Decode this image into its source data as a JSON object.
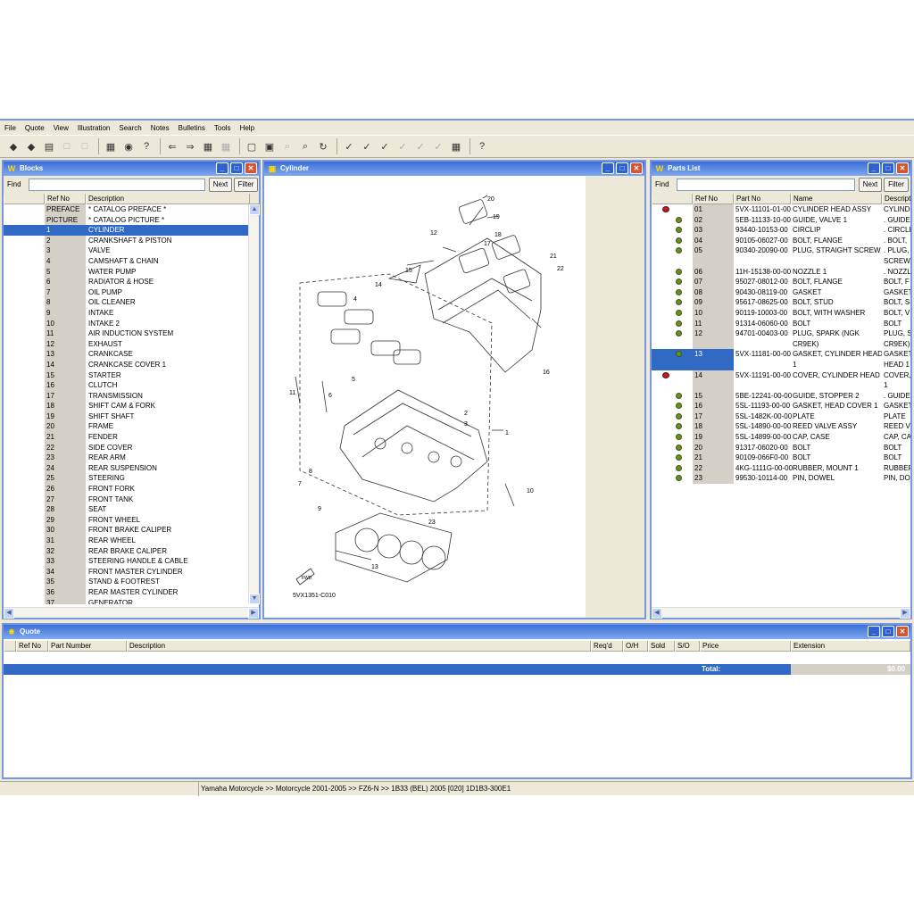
{
  "menu": [
    "File",
    "Quote",
    "View",
    "Illustration",
    "Search",
    "Notes",
    "Bulletins",
    "Tools",
    "Help"
  ],
  "blocks": {
    "title": "Blocks",
    "find_label": "Find",
    "next_label": "Next",
    "filter_label": "Filter",
    "headers": [
      "Ref No",
      "Description"
    ],
    "rows": [
      [
        "PREFACE",
        "* CATALOG PREFACE *"
      ],
      [
        "PICTURE",
        "* CATALOG PICTURE *"
      ],
      [
        "1",
        "CYLINDER"
      ],
      [
        "2",
        "CRANKSHAFT & PISTON"
      ],
      [
        "3",
        "VALVE"
      ],
      [
        "4",
        "CAMSHAFT & CHAIN"
      ],
      [
        "5",
        "WATER PUMP"
      ],
      [
        "6",
        "RADIATOR & HOSE"
      ],
      [
        "7",
        "OIL PUMP"
      ],
      [
        "8",
        "OIL CLEANER"
      ],
      [
        "9",
        "INTAKE"
      ],
      [
        "10",
        "INTAKE 2"
      ],
      [
        "11",
        "AIR INDUCTION SYSTEM"
      ],
      [
        "12",
        "EXHAUST"
      ],
      [
        "13",
        "CRANKCASE"
      ],
      [
        "14",
        "CRANKCASE COVER 1"
      ],
      [
        "15",
        "STARTER"
      ],
      [
        "16",
        "CLUTCH"
      ],
      [
        "17",
        "TRANSMISSION"
      ],
      [
        "18",
        "SHIFT CAM & FORK"
      ],
      [
        "19",
        "SHIFT SHAFT"
      ],
      [
        "20",
        "FRAME"
      ],
      [
        "21",
        "FENDER"
      ],
      [
        "22",
        "SIDE COVER"
      ],
      [
        "23",
        "REAR ARM"
      ],
      [
        "24",
        "REAR SUSPENSION"
      ],
      [
        "25",
        "STEERING"
      ],
      [
        "26",
        "FRONT FORK"
      ],
      [
        "27",
        "FRONT TANK"
      ],
      [
        "28",
        "SEAT"
      ],
      [
        "29",
        "FRONT WHEEL"
      ],
      [
        "30",
        "FRONT BRAKE CALIPER"
      ],
      [
        "31",
        "REAR WHEEL"
      ],
      [
        "32",
        "REAR BRAKE CALIPER"
      ],
      [
        "33",
        "STEERING HANDLE & CABLE"
      ],
      [
        "34",
        "FRONT MASTER CYLINDER"
      ],
      [
        "35",
        "STAND & FOOTREST"
      ],
      [
        "36",
        "REAR MASTER CYLINDER"
      ],
      [
        "37",
        "GENERATOR"
      ]
    ]
  },
  "cylinder": {
    "title": "Cylinder",
    "diagram_code": "5VX1351-C010",
    "fwd_label": "FWD",
    "callouts": [
      "20",
      "19",
      "18",
      "17",
      "16",
      "15",
      "14",
      "12",
      "22",
      "21",
      "4",
      "1",
      "2",
      "3",
      "5",
      "6",
      "7",
      "8",
      "9",
      "10",
      "11",
      "13",
      "23"
    ]
  },
  "parts": {
    "title": "Parts List",
    "find_label": "Find",
    "next_label": "Next",
    "filter_label": "Filter",
    "headers": [
      "Ref No",
      "Part No",
      "Name",
      "Descript"
    ],
    "rows": [
      {
        "icon": "red",
        "ref": "01",
        "part": "5VX-11101-01-00",
        "name": "CYLINDER HEAD ASSY",
        "desc": "CYLIND"
      },
      {
        "icon": "green",
        "ref": "02",
        "part": "5EB-11133-10-00",
        "name": "GUIDE, VALVE 1",
        "desc": ". GUIDE"
      },
      {
        "icon": "green",
        "ref": "03",
        "part": "93440-10153-00",
        "name": "CIRCLIP",
        "desc": ". CIRCLI"
      },
      {
        "icon": "green",
        "ref": "04",
        "part": "90105-06027-00",
        "name": "BOLT, FLANGE",
        "desc": ". BOLT,"
      },
      {
        "icon": "green",
        "ref": "05",
        "part": "90340-20090-00",
        "name": "PLUG, STRAIGHT SCREW",
        "desc": ". PLUG,",
        "name2": "",
        "desc2": "SCREW"
      },
      {
        "icon": "green",
        "ref": "06",
        "part": "11H-15138-00-00",
        "name": "NOZZLE 1",
        "desc": ". NOZZL"
      },
      {
        "icon": "green",
        "ref": "07",
        "part": "95027-08012-00",
        "name": "BOLT, FLANGE",
        "desc": "BOLT, F"
      },
      {
        "icon": "green",
        "ref": "08",
        "part": "90430-08119-00",
        "name": "GASKET",
        "desc": "GASKET"
      },
      {
        "icon": "green",
        "ref": "09",
        "part": "95617-08625-00",
        "name": "BOLT, STUD",
        "desc": "BOLT, S"
      },
      {
        "icon": "green",
        "ref": "10",
        "part": "90119-10003-00",
        "name": "BOLT, WITH WASHER",
        "desc": "BOLT, V"
      },
      {
        "icon": "green",
        "ref": "11",
        "part": "91314-06060-00",
        "name": "BOLT",
        "desc": "BOLT"
      },
      {
        "icon": "green",
        "ref": "12",
        "part": "94701-00403-00",
        "name": "PLUG, SPARK (NGK",
        "desc": "PLUG, S",
        "name2": "CR9EK)",
        "desc2": "CR9EK)"
      },
      {
        "icon": "green",
        "ref": "13",
        "part": "5VX-11181-00-00",
        "name": "GASKET, CYLINDER HEAD",
        "desc": "GASKET",
        "name2": "1",
        "desc2": "HEAD 1",
        "selected": true
      },
      {
        "icon": "red",
        "ref": "14",
        "part": "5VX-11191-00-00",
        "name": "COVER, CYLINDER HEAD 1",
        "desc": "COVER,",
        "name2": "",
        "desc2": "1"
      },
      {
        "icon": "green",
        "ref": "15",
        "part": "5BE-12241-00-00",
        "name": "GUIDE, STOPPER 2",
        "desc": ". GUIDE"
      },
      {
        "icon": "green",
        "ref": "16",
        "part": "5SL-11193-00-00",
        "name": "GASKET, HEAD COVER 1",
        "desc": "GASKET"
      },
      {
        "icon": "green",
        "ref": "17",
        "part": "5SL-1482K-00-00",
        "name": "PLATE",
        "desc": "PLATE"
      },
      {
        "icon": "green",
        "ref": "18",
        "part": "5SL-14890-00-00",
        "name": "REED VALVE ASSY",
        "desc": "REED V"
      },
      {
        "icon": "green",
        "ref": "19",
        "part": "5SL-14899-00-00",
        "name": "CAP, CASE",
        "desc": "CAP, CA"
      },
      {
        "icon": "green",
        "ref": "20",
        "part": "91317-06020-00",
        "name": "BOLT",
        "desc": "BOLT"
      },
      {
        "icon": "green",
        "ref": "21",
        "part": "90109-066F0-00",
        "name": "BOLT",
        "desc": "BOLT"
      },
      {
        "icon": "green",
        "ref": "22",
        "part": "4KG-1111G-00-00",
        "name": "RUBBER, MOUNT 1",
        "desc": "RUBBEF"
      },
      {
        "icon": "green",
        "ref": "23",
        "part": "99530-10114-00",
        "name": "PIN, DOWEL",
        "desc": "PIN, DO"
      }
    ]
  },
  "quote": {
    "title": "Quote",
    "headers": [
      "Ref No",
      "Part Number",
      "Description",
      "Req'd",
      "O/H",
      "Sold",
      "S/O",
      "Price",
      "Extension"
    ],
    "total_label": "Total:",
    "total_value": "$0.00"
  },
  "status": "Yamaha Motorcycle >> Motorcycle 2001-2005 >> FZ6-N >> 1B33 (BEL) 2005 [020] 1D1B3-300E1",
  "colors": {
    "title_blue": "#3a6fd8",
    "selection": "#316ac5",
    "window_bg": "#ece9d8"
  }
}
